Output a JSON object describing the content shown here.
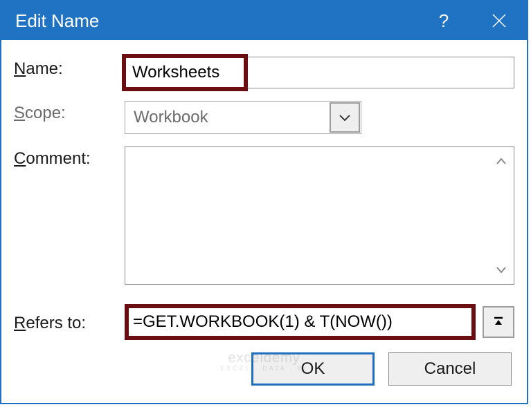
{
  "titlebar": {
    "title": "Edit Name",
    "help": "?",
    "close": "×"
  },
  "labels": {
    "name": "Name:",
    "scope": "Scope:",
    "comment": "Comment:",
    "refers": "Refers to:"
  },
  "fields": {
    "name_value": "Worksheets",
    "scope_value": "Workbook",
    "comment_value": "",
    "refers_value": "=GET.WORKBOOK(1) & T(NOW())"
  },
  "buttons": {
    "ok": "OK",
    "cancel": "Cancel"
  },
  "watermark": {
    "main": "exceldemy",
    "sub": "EXCEL · DATA · BI"
  },
  "colors": {
    "titlebar": "#2072C2",
    "highlight": "#6b0e12",
    "primary_border": "#1f6fc0"
  }
}
